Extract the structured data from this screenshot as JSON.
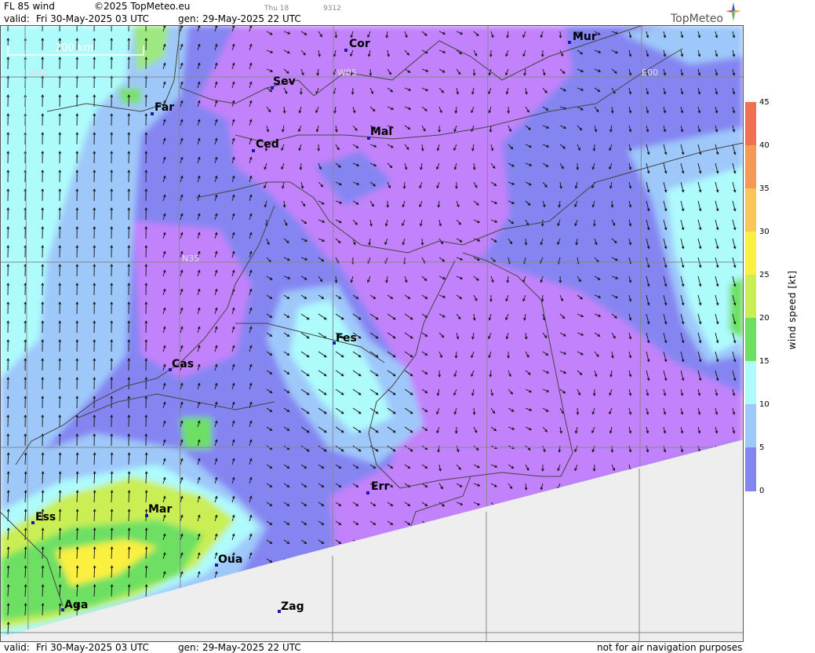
{
  "header": {
    "title": "FL 85 wind",
    "copyright": "©2025 TopMeteo.eu",
    "valid_label": "valid:",
    "valid_value": "Fri  30-May-2025  03 UTC",
    "gen_label": "gen:",
    "gen_value": "29-May-2025 22 UTC",
    "small_day": "Thu 18",
    "small_code": "9312",
    "brand": "TopMeteo"
  },
  "map": {
    "scale_label": "200 km",
    "grid_labels": [
      "W10",
      "W05",
      "E00",
      "N35"
    ],
    "cities": [
      {
        "name": "Cor"
      },
      {
        "name": "Mur"
      },
      {
        "name": "Sev"
      },
      {
        "name": "Far"
      },
      {
        "name": "Mal"
      },
      {
        "name": "Ced"
      },
      {
        "name": "Fes"
      },
      {
        "name": "Cas"
      },
      {
        "name": "Err"
      },
      {
        "name": "Mar"
      },
      {
        "name": "Ess"
      },
      {
        "name": "Oua"
      },
      {
        "name": "Aga"
      },
      {
        "name": "Zag"
      }
    ]
  },
  "legend": {
    "title": "wind  speed  [kt]",
    "ticks": [
      "45",
      "40",
      "35",
      "30",
      "25",
      "20",
      "15",
      "10",
      "5",
      "0"
    ],
    "colors": [
      "#f07050",
      "#f59a55",
      "#fbc55a",
      "#fbf040",
      "#c9ef55",
      "#6de063",
      "#aefbfc",
      "#9ec8fa",
      "#8585f2",
      "#c282fb"
    ]
  },
  "footer": {
    "valid_label": "valid:",
    "valid_value": "Fri  30-May-2025  03 UTC",
    "gen_label": "gen:",
    "gen_value": "29-May-2025 22 UTC",
    "disclaimer": "not for air navigation purposes"
  }
}
